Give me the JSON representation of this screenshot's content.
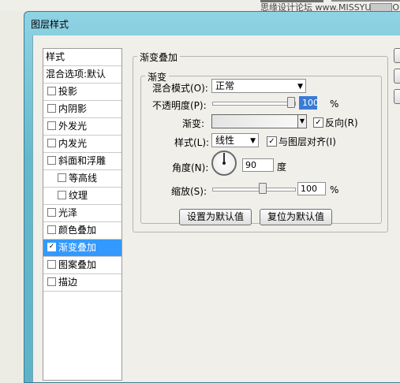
{
  "host": {
    "watermark": "思缘设计论坛 www.MISSYUAN.COM"
  },
  "dialog": {
    "title": "图层样式"
  },
  "styles_list": {
    "header": "样式",
    "blend_default": "混合选项:默认",
    "items": [
      {
        "label": "投影",
        "checked": false
      },
      {
        "label": "内阴影",
        "checked": false
      },
      {
        "label": "外发光",
        "checked": false
      },
      {
        "label": "内发光",
        "checked": false
      },
      {
        "label": "斜面和浮雕",
        "checked": false
      },
      {
        "label": "等高线",
        "checked": false
      },
      {
        "label": "纹理",
        "checked": false
      },
      {
        "label": "光泽",
        "checked": false
      },
      {
        "label": "颜色叠加",
        "checked": false
      },
      {
        "label": "渐变叠加",
        "checked": true,
        "selected": true
      },
      {
        "label": "图案叠加",
        "checked": false
      },
      {
        "label": "描边",
        "checked": false
      }
    ]
  },
  "gradient_overlay": {
    "group_title": "渐变叠加",
    "subgroup_title": "渐变",
    "blend_mode_label": "混合模式(O):",
    "blend_mode_value": "正常",
    "opacity_label": "不透明度(P):",
    "opacity_value": "100",
    "percent": "%",
    "gradient_label": "渐变:",
    "reverse_label": "反向(R)",
    "reverse_checked": true,
    "style_label": "样式(L):",
    "style_value": "线性",
    "align_label": "与图层对齐(I)",
    "align_checked": true,
    "angle_label": "角度(N):",
    "angle_value": "90",
    "angle_unit": "度",
    "scale_label": "缩放(S):",
    "scale_value": "100",
    "set_default_button": "设置为默认值",
    "reset_default_button": "复位为默认值"
  },
  "checkmark": "✓",
  "dropdown_arrow": "▼"
}
